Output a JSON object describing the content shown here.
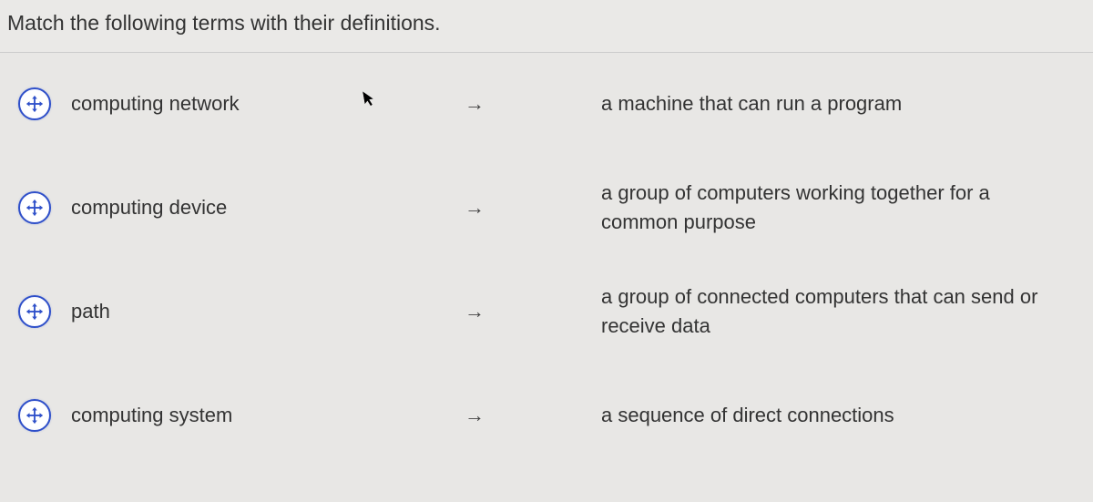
{
  "prompt": "Match the following terms with their definitions.",
  "arrow": "→",
  "rows": [
    {
      "term": "computing network",
      "definition": "a machine that can run a program"
    },
    {
      "term": "computing device",
      "definition": "a group of computers working together for a common purpose"
    },
    {
      "term": "path",
      "definition": "a group of connected computers that can send or receive data"
    },
    {
      "term": "computing system",
      "definition": "a sequence of direct connections"
    }
  ]
}
